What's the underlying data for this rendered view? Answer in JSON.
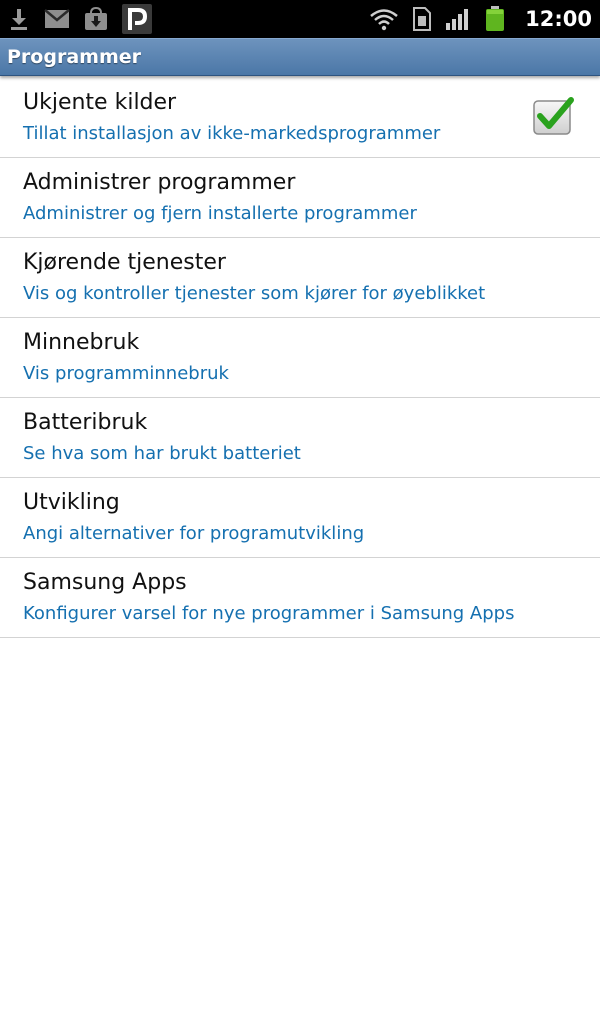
{
  "status_bar": {
    "time": "12:00",
    "left_icons": [
      "download-icon",
      "gmail-icon",
      "market-download-icon",
      "p-app-icon"
    ],
    "right_icons": [
      "wifi-icon",
      "sim-icon",
      "signal-icon",
      "battery-icon"
    ]
  },
  "header": {
    "title": "Programmer"
  },
  "items": [
    {
      "title": "Ukjente kilder",
      "subtitle": "Tillat installasjon av ikke-markedsprogrammer",
      "checked": true
    },
    {
      "title": "Administrer programmer",
      "subtitle": "Administrer og fjern installerte programmer"
    },
    {
      "title": "Kjørende tjenester",
      "subtitle": "Vis og kontroller tjenester som kjører for øyeblikket"
    },
    {
      "title": "Minnebruk",
      "subtitle": "Vis programminnebruk"
    },
    {
      "title": "Batteribruk",
      "subtitle": "Se hva som har brukt batteriet"
    },
    {
      "title": "Utvikling",
      "subtitle": "Angi alternativer for programutvikling"
    },
    {
      "title": "Samsung Apps",
      "subtitle": "Konfigurer varsel for nye programmer i Samsung Apps"
    }
  ],
  "colors": {
    "accent": "#1570b0",
    "titlebar": "#5b84b3",
    "check": "#2aa21e"
  }
}
